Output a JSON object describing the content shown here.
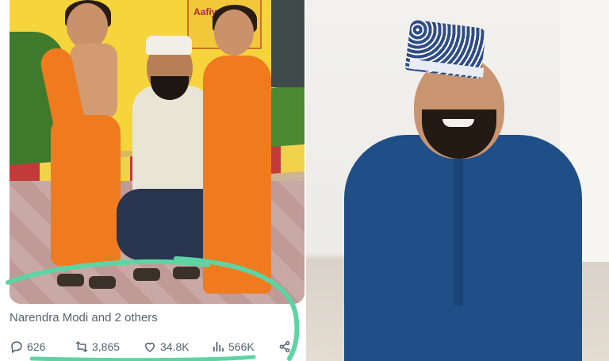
{
  "post": {
    "author_line": "Narendra Modi and 2 others",
    "photo_sign_text": "Aafiya",
    "actions": {
      "replies": "626",
      "reposts": "3,865",
      "likes": "34.8K",
      "views": "566K"
    },
    "icons": [
      "reply-icon",
      "repost-icon",
      "like-icon",
      "views-icon",
      "share-icon"
    ],
    "highlight_color": "#5fd3a3"
  },
  "colors": {
    "text_muted": "#536471",
    "robe_blue": "#1f4f86",
    "saffron": "#f07a1e"
  }
}
